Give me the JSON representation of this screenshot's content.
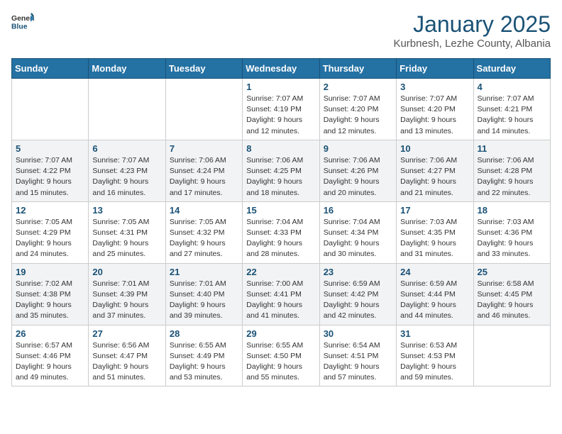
{
  "header": {
    "logo_general": "General",
    "logo_blue": "Blue",
    "title": "January 2025",
    "subtitle": "Kurbnesh, Lezhe County, Albania"
  },
  "weekdays": [
    "Sunday",
    "Monday",
    "Tuesday",
    "Wednesday",
    "Thursday",
    "Friday",
    "Saturday"
  ],
  "weeks": [
    [
      {
        "day": "",
        "info": ""
      },
      {
        "day": "",
        "info": ""
      },
      {
        "day": "",
        "info": ""
      },
      {
        "day": "1",
        "info": "Sunrise: 7:07 AM\nSunset: 4:19 PM\nDaylight: 9 hours and 12 minutes."
      },
      {
        "day": "2",
        "info": "Sunrise: 7:07 AM\nSunset: 4:20 PM\nDaylight: 9 hours and 12 minutes."
      },
      {
        "day": "3",
        "info": "Sunrise: 7:07 AM\nSunset: 4:20 PM\nDaylight: 9 hours and 13 minutes."
      },
      {
        "day": "4",
        "info": "Sunrise: 7:07 AM\nSunset: 4:21 PM\nDaylight: 9 hours and 14 minutes."
      }
    ],
    [
      {
        "day": "5",
        "info": "Sunrise: 7:07 AM\nSunset: 4:22 PM\nDaylight: 9 hours and 15 minutes."
      },
      {
        "day": "6",
        "info": "Sunrise: 7:07 AM\nSunset: 4:23 PM\nDaylight: 9 hours and 16 minutes."
      },
      {
        "day": "7",
        "info": "Sunrise: 7:06 AM\nSunset: 4:24 PM\nDaylight: 9 hours and 17 minutes."
      },
      {
        "day": "8",
        "info": "Sunrise: 7:06 AM\nSunset: 4:25 PM\nDaylight: 9 hours and 18 minutes."
      },
      {
        "day": "9",
        "info": "Sunrise: 7:06 AM\nSunset: 4:26 PM\nDaylight: 9 hours and 20 minutes."
      },
      {
        "day": "10",
        "info": "Sunrise: 7:06 AM\nSunset: 4:27 PM\nDaylight: 9 hours and 21 minutes."
      },
      {
        "day": "11",
        "info": "Sunrise: 7:06 AM\nSunset: 4:28 PM\nDaylight: 9 hours and 22 minutes."
      }
    ],
    [
      {
        "day": "12",
        "info": "Sunrise: 7:05 AM\nSunset: 4:29 PM\nDaylight: 9 hours and 24 minutes."
      },
      {
        "day": "13",
        "info": "Sunrise: 7:05 AM\nSunset: 4:31 PM\nDaylight: 9 hours and 25 minutes."
      },
      {
        "day": "14",
        "info": "Sunrise: 7:05 AM\nSunset: 4:32 PM\nDaylight: 9 hours and 27 minutes."
      },
      {
        "day": "15",
        "info": "Sunrise: 7:04 AM\nSunset: 4:33 PM\nDaylight: 9 hours and 28 minutes."
      },
      {
        "day": "16",
        "info": "Sunrise: 7:04 AM\nSunset: 4:34 PM\nDaylight: 9 hours and 30 minutes."
      },
      {
        "day": "17",
        "info": "Sunrise: 7:03 AM\nSunset: 4:35 PM\nDaylight: 9 hours and 31 minutes."
      },
      {
        "day": "18",
        "info": "Sunrise: 7:03 AM\nSunset: 4:36 PM\nDaylight: 9 hours and 33 minutes."
      }
    ],
    [
      {
        "day": "19",
        "info": "Sunrise: 7:02 AM\nSunset: 4:38 PM\nDaylight: 9 hours and 35 minutes."
      },
      {
        "day": "20",
        "info": "Sunrise: 7:01 AM\nSunset: 4:39 PM\nDaylight: 9 hours and 37 minutes."
      },
      {
        "day": "21",
        "info": "Sunrise: 7:01 AM\nSunset: 4:40 PM\nDaylight: 9 hours and 39 minutes."
      },
      {
        "day": "22",
        "info": "Sunrise: 7:00 AM\nSunset: 4:41 PM\nDaylight: 9 hours and 41 minutes."
      },
      {
        "day": "23",
        "info": "Sunrise: 6:59 AM\nSunset: 4:42 PM\nDaylight: 9 hours and 42 minutes."
      },
      {
        "day": "24",
        "info": "Sunrise: 6:59 AM\nSunset: 4:44 PM\nDaylight: 9 hours and 44 minutes."
      },
      {
        "day": "25",
        "info": "Sunrise: 6:58 AM\nSunset: 4:45 PM\nDaylight: 9 hours and 46 minutes."
      }
    ],
    [
      {
        "day": "26",
        "info": "Sunrise: 6:57 AM\nSunset: 4:46 PM\nDaylight: 9 hours and 49 minutes."
      },
      {
        "day": "27",
        "info": "Sunrise: 6:56 AM\nSunset: 4:47 PM\nDaylight: 9 hours and 51 minutes."
      },
      {
        "day": "28",
        "info": "Sunrise: 6:55 AM\nSunset: 4:49 PM\nDaylight: 9 hours and 53 minutes."
      },
      {
        "day": "29",
        "info": "Sunrise: 6:55 AM\nSunset: 4:50 PM\nDaylight: 9 hours and 55 minutes."
      },
      {
        "day": "30",
        "info": "Sunrise: 6:54 AM\nSunset: 4:51 PM\nDaylight: 9 hours and 57 minutes."
      },
      {
        "day": "31",
        "info": "Sunrise: 6:53 AM\nSunset: 4:53 PM\nDaylight: 9 hours and 59 minutes."
      },
      {
        "day": "",
        "info": ""
      }
    ]
  ]
}
